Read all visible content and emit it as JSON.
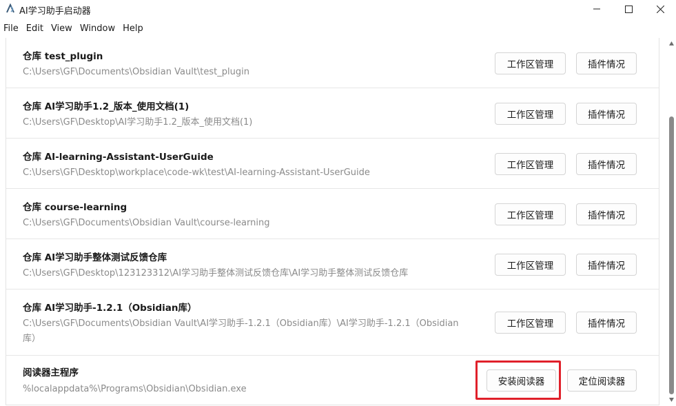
{
  "window": {
    "title": "AI学习助手启动器",
    "app_icon": "ai-logo-icon",
    "controls": [
      "minimize-icon",
      "maximize-icon",
      "close-icon"
    ]
  },
  "menu": [
    "File",
    "Edit",
    "View",
    "Window",
    "Help"
  ],
  "repos": [
    {
      "title": "仓库 test_plugin",
      "path": "C:\\Users\\GF\\Documents\\Obsidian Vault\\test_plugin",
      "workspace_btn": "工作区管理",
      "plugin_btn": "插件情况"
    },
    {
      "title": "仓库 AI学习助手1.2_版本_使用文档(1)",
      "path": "C:\\Users\\GF\\Desktop\\AI学习助手1.2_版本_使用文档(1)",
      "workspace_btn": "工作区管理",
      "plugin_btn": "插件情况"
    },
    {
      "title": "仓库 AI-learning-Assistant-UserGuide",
      "path": "C:\\Users\\GF\\Desktop\\workplace\\code-wk\\test\\AI-learning-Assistant-UserGuide",
      "workspace_btn": "工作区管理",
      "plugin_btn": "插件情况"
    },
    {
      "title": "仓库 course-learning",
      "path": "C:\\Users\\GF\\Documents\\Obsidian Vault\\course-learning",
      "workspace_btn": "工作区管理",
      "plugin_btn": "插件情况"
    },
    {
      "title": "仓库 AI学习助手整体测试反馈仓库",
      "path": "C:\\Users\\GF\\Desktop\\123123312\\AI学习助手整体测试反馈仓库\\AI学习助手整体测试反馈仓库",
      "workspace_btn": "工作区管理",
      "plugin_btn": "插件情况"
    },
    {
      "title": "仓库 AI学习助手-1.2.1（Obsidian库）",
      "path": "C:\\Users\\GF\\Documents\\Obsidian Vault\\AI学习助手-1.2.1（Obsidian库）\\AI学习助手-1.2.1（Obsidian库）",
      "workspace_btn": "工作区管理",
      "plugin_btn": "插件情况"
    }
  ],
  "reader": {
    "title": "阅读器主程序",
    "path": "%localappdata%\\Programs\\Obsidian\\Obsidian.exe",
    "install_btn": "安装阅读器",
    "locate_btn": "定位阅读器"
  },
  "colors": {
    "highlight": "#e0202a",
    "path_text": "#8a8a8a",
    "scrollbar_thumb": "#8a8a8a"
  }
}
